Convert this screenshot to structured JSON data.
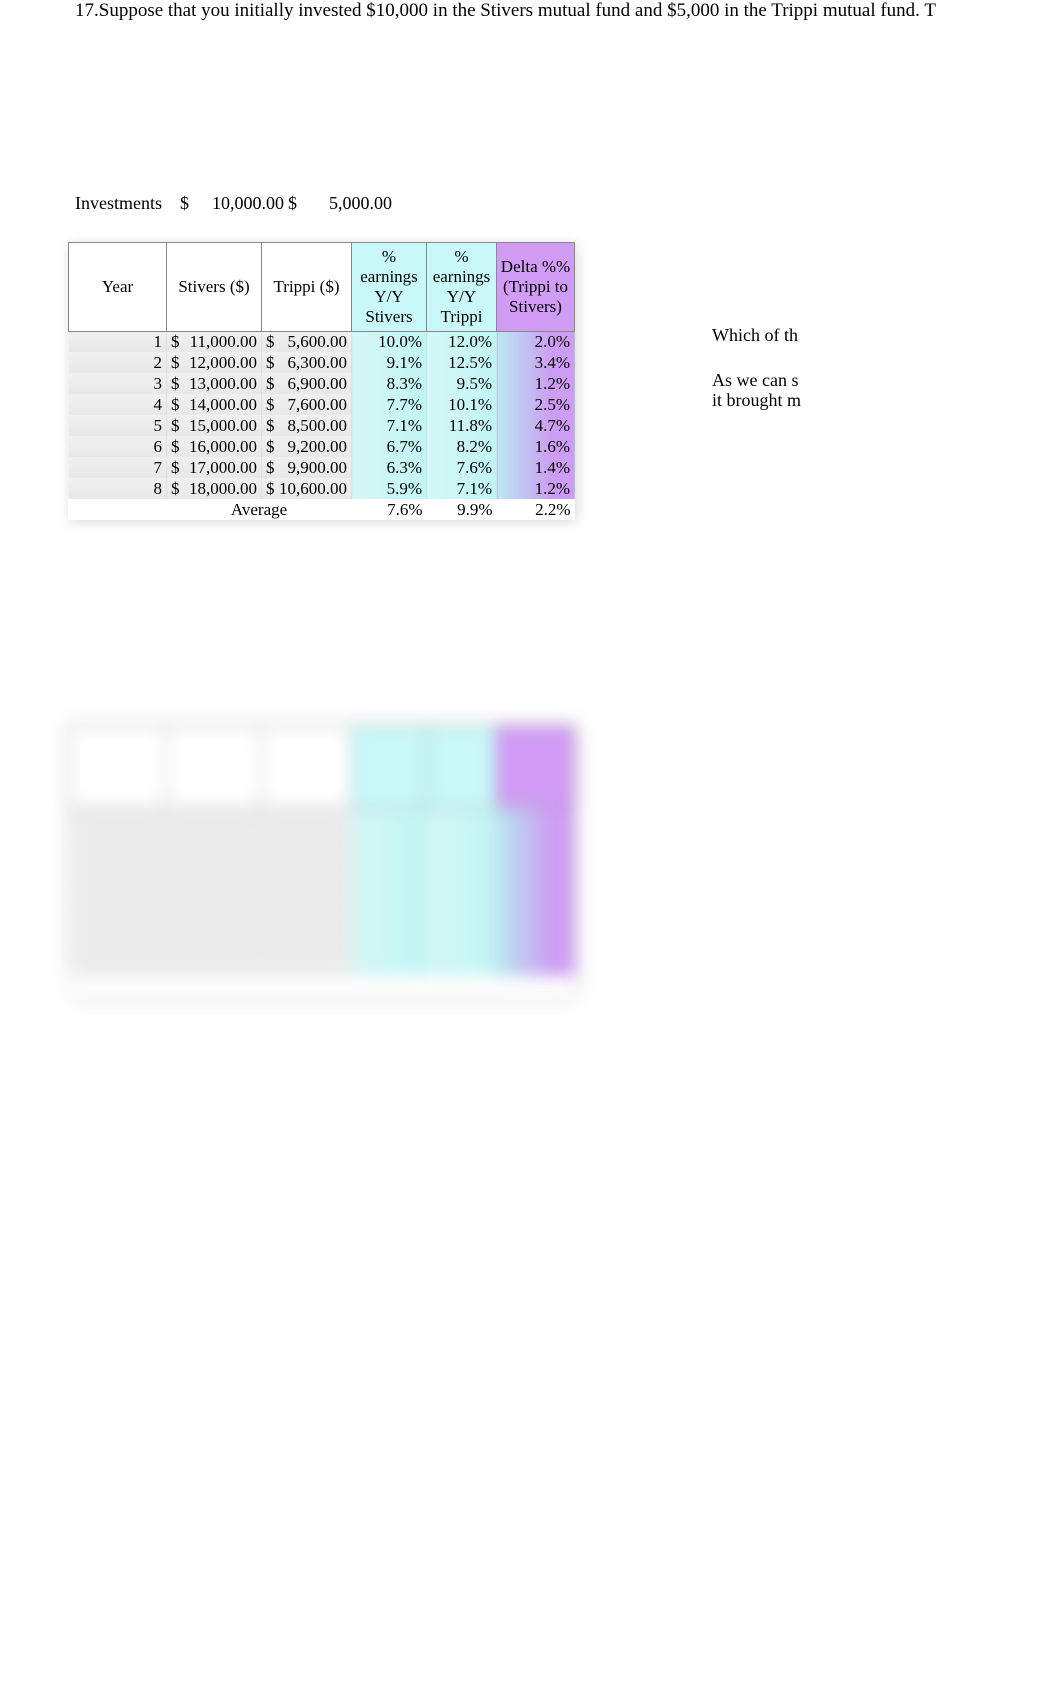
{
  "question": "17.Suppose that you initially invested $10,000 in the Stivers mutual fund and $5,000 in the Trippi mutual fund. T",
  "investments": {
    "label": "Investments",
    "stivers_sym": "$",
    "stivers_val": "10,000.00",
    "trippi_sym": "$",
    "trippi_val": "5,000.00"
  },
  "headers": {
    "year": "Year",
    "stivers": "Stivers ($)",
    "trippi": "Trippi ($)",
    "pct_stivers": "% earnings Y/Y Stivers",
    "pct_trippi": "% earnings Y/Y Trippi",
    "delta": "Delta %% (Trippi to Stivers)"
  },
  "rows": [
    {
      "year": "1",
      "ss": "$",
      "sv": "11,000.00",
      "ts": "$",
      "tv": "5,600.00",
      "p1": "10.0%",
      "p2": "12.0%",
      "d": "2.0%"
    },
    {
      "year": "2",
      "ss": "$",
      "sv": "12,000.00",
      "ts": "$",
      "tv": "6,300.00",
      "p1": "9.1%",
      "p2": "12.5%",
      "d": "3.4%"
    },
    {
      "year": "3",
      "ss": "$",
      "sv": "13,000.00",
      "ts": "$",
      "tv": "6,900.00",
      "p1": "8.3%",
      "p2": "9.5%",
      "d": "1.2%"
    },
    {
      "year": "4",
      "ss": "$",
      "sv": "14,000.00",
      "ts": "$",
      "tv": "7,600.00",
      "p1": "7.7%",
      "p2": "10.1%",
      "d": "2.5%"
    },
    {
      "year": "5",
      "ss": "$",
      "sv": "15,000.00",
      "ts": "$",
      "tv": "8,500.00",
      "p1": "7.1%",
      "p2": "11.8%",
      "d": "4.7%"
    },
    {
      "year": "6",
      "ss": "$",
      "sv": "16,000.00",
      "ts": "$",
      "tv": "9,200.00",
      "p1": "6.7%",
      "p2": "8.2%",
      "d": "1.6%"
    },
    {
      "year": "7",
      "ss": "$",
      "sv": "17,000.00",
      "ts": "$",
      "tv": "9,900.00",
      "p1": "6.3%",
      "p2": "7.6%",
      "d": "1.4%"
    },
    {
      "year": "8",
      "ss": "$",
      "sv": "18,000.00",
      "ts": "$",
      "tv": "10,600.00",
      "p1": "5.9%",
      "p2": "7.1%",
      "d": "1.2%"
    }
  ],
  "average": {
    "label": "Average",
    "p1": "7.6%",
    "p2": "9.9%",
    "d": "2.2%"
  },
  "side": {
    "line1": "Which of th",
    "line2": "As we can s",
    "line3": "it brought m"
  }
}
